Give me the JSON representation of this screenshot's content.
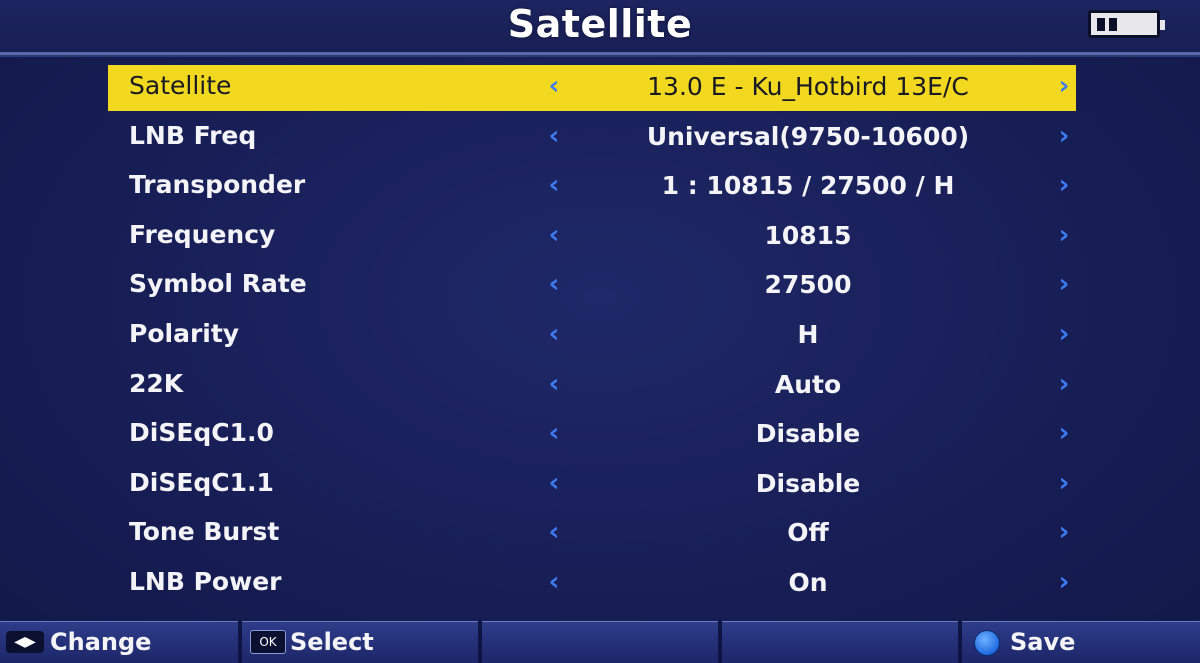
{
  "header": {
    "title": "Satellite"
  },
  "menu": {
    "rows": [
      {
        "label": "Satellite",
        "value": "13.0 E - Ku_Hotbird 13E/C",
        "selected": true
      },
      {
        "label": "LNB Freq",
        "value": "Universal(9750-10600)"
      },
      {
        "label": "Transponder",
        "value": "1 : 10815 / 27500 / H"
      },
      {
        "label": "Frequency",
        "value": "10815"
      },
      {
        "label": "Symbol Rate",
        "value": "27500"
      },
      {
        "label": "Polarity",
        "value": "H"
      },
      {
        "label": "22K",
        "value": "Auto"
      },
      {
        "label": "DiSEqC1.0",
        "value": "Disable"
      },
      {
        "label": "DiSEqC1.1",
        "value": "Disable"
      },
      {
        "label": "Tone Burst",
        "value": "Off"
      },
      {
        "label": "LNB Power",
        "value": "On"
      }
    ],
    "arrow_left": "‹",
    "arrow_right": "›"
  },
  "footer": {
    "change_key": "◀▶",
    "change_label": "Change",
    "ok_key": "OK",
    "select_label": "Select",
    "save_label": "Save"
  },
  "colors": {
    "background": "#19205a",
    "highlight": "#f2d81f",
    "arrow": "#3d7cf5",
    "save_button": "#1e6be0"
  },
  "icons": {
    "battery": "battery-icon",
    "left_right_key": "left-right-key-icon",
    "ok_key": "ok-key-icon",
    "blue_button": "blue-button-icon"
  }
}
